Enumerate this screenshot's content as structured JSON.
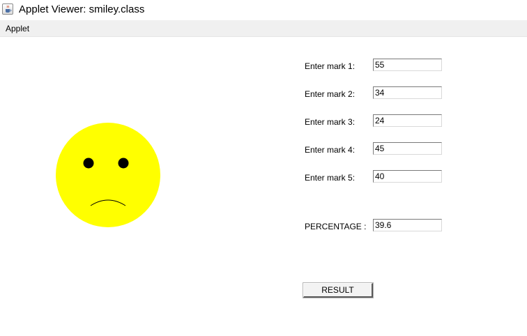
{
  "window": {
    "title": "Applet Viewer: smiley.class",
    "icon": "java-coffee-icon"
  },
  "menubar": {
    "items": [
      {
        "label": "Applet"
      }
    ]
  },
  "face": {
    "expression": "sad",
    "face_color": "#ffff00",
    "eye_color": "#000000",
    "icon": "sad-face-icon"
  },
  "form": {
    "marks": [
      {
        "label": "Enter mark 1:",
        "value": "55"
      },
      {
        "label": "Enter mark 2:",
        "value": "34"
      },
      {
        "label": "Enter mark 3:",
        "value": "24"
      },
      {
        "label": "Enter mark 4:",
        "value": "45"
      },
      {
        "label": "Enter mark 5:",
        "value": "40"
      }
    ],
    "percentage": {
      "label": "PERCENTAGE :",
      "value": "39.6"
    },
    "result_button": {
      "label": "RESULT"
    }
  }
}
